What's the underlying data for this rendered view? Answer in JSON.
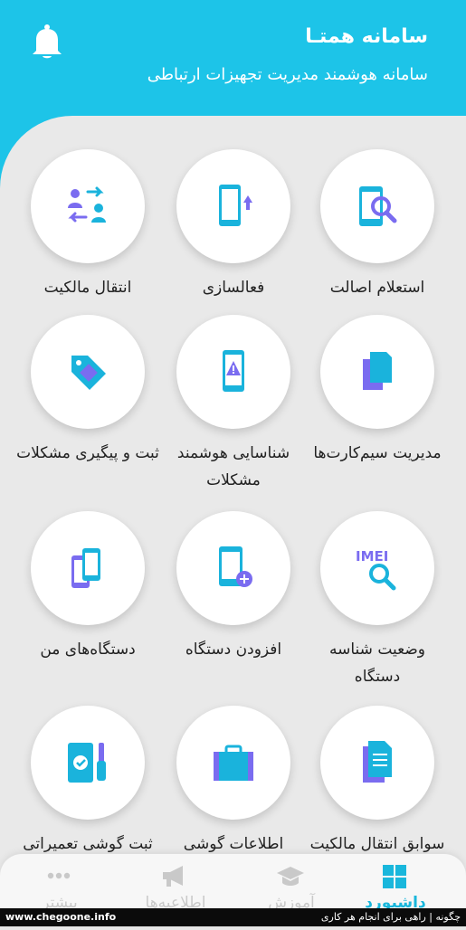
{
  "header": {
    "title": "سامانه همتـا",
    "subtitle": "سامانه هوشمند مدیریت تجهیزات ارتباطی",
    "bell_icon": "bell-icon"
  },
  "colors": {
    "accent": "#1dc4e8",
    "icon_blue": "#1ab3dc",
    "icon_purple": "#7a6cf0",
    "background": "#e9e9e9"
  },
  "tiles": [
    {
      "label": "استعلام اصالت",
      "icon": "phone-search-icon"
    },
    {
      "label": "فعالسازی",
      "icon": "phone-activate-icon"
    },
    {
      "label": "انتقال مالکیت",
      "icon": "transfer-ownership-icon"
    },
    {
      "label": "مدیریت سیم‌کارت‌ها",
      "icon": "sim-cards-icon"
    },
    {
      "label": "شناسایی هوشمند مشکلات",
      "icon": "phone-warning-icon"
    },
    {
      "label": "ثبت و پیگیری مشکلات",
      "icon": "tag-icon"
    },
    {
      "label": "وضعیت شناسه دستگاه",
      "icon": "imei-search-icon"
    },
    {
      "label": "افزودن دستگاه",
      "icon": "add-device-icon"
    },
    {
      "label": "دستگاه‌های من",
      "icon": "my-devices-icon"
    },
    {
      "label": "سوابق انتقال مالکیت",
      "icon": "documents-icon"
    },
    {
      "label": "اطلاعات گوشی",
      "icon": "briefcase-icon"
    },
    {
      "label": "ثبت گوشی تعمیراتی",
      "icon": "repair-phone-icon"
    }
  ],
  "nav": [
    {
      "label": "داشبورد",
      "icon": "grid-icon"
    },
    {
      "label": "آموزش",
      "icon": "graduation-cap-icon"
    },
    {
      "label": "اطلاعیه‌ها",
      "icon": "megaphone-icon"
    },
    {
      "label": "بیشتر",
      "icon": "more-icon"
    }
  ],
  "footer": {
    "site": "www.chegoone.info",
    "tagline": "چگونه | راهی برای انجام هر کاری"
  }
}
